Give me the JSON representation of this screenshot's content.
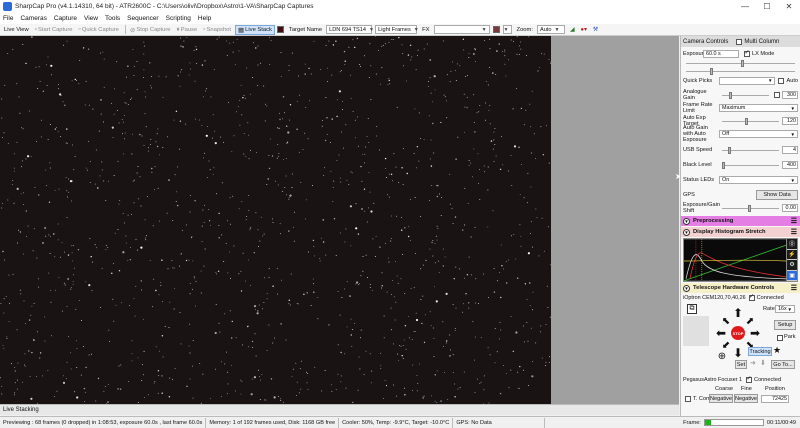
{
  "window": {
    "title": "SharpCap Pro (v4.1.14310, 64 bit) - ATR2600C - C:\\Users\\olivi\\Dropbox\\Astro\\1-VA\\SharpCap Captures",
    "minimize": "—",
    "maximize": "☐",
    "close": "✕"
  },
  "menu": [
    "File",
    "Cameras",
    "Capture",
    "View",
    "Tools",
    "Sequencer",
    "Scripting",
    "Help"
  ],
  "toolbar": {
    "live_view": "Live View",
    "start_capture": "Start Capture",
    "quick_capture": "Quick Capture",
    "stop_capture": "Stop Capture",
    "pause": "Pause",
    "snapshot": "Snapshot",
    "live_stack": "Live Stack",
    "target_name_label": "Target Name",
    "target_name_value": "LDN 694 TS14",
    "frame_type": "Light Frames",
    "fx_label": "FX",
    "zoom_label": "Zoom:",
    "zoom_value": "Auto",
    "colors": {
      "swatch1": "#3a1010",
      "swatch2": "#7a3a3a"
    }
  },
  "bottom_tab": "Live Stacking",
  "status": {
    "previewing": "Previewing : 68 frames (0 dropped) in 1:08:53, exposure 60.0s , last frame 60.0s",
    "memory": "Memory: 1 of 192 frames used, Disk: 1168 GB free",
    "cooler": "Cooler: 50%, Temp: -9.9°C, Target: -10.0°C",
    "gps": "GPS: No Data",
    "frame_label": "Frame:",
    "frame_progress": 0.1,
    "frame_time": "00:11/00:49"
  },
  "panel": {
    "header": "Camera Controls",
    "multi_column": "Multi Column",
    "exposure_label": "Exposure",
    "exposure_value": "60.0 s",
    "lx_mode": "LX Mode",
    "quick_picks": "Quick Picks",
    "auto": "Auto",
    "analogue_gain_label": "Analogue Gain",
    "analogue_gain_value": "300",
    "frame_rate_label": "Frame Rate Limit",
    "frame_rate_value": "Maximum",
    "auto_exp_target_label": "Auto Exp Target",
    "auto_exp_target_value": "120",
    "auto_gain_label": "Auto Gain with Auto Exposure",
    "auto_gain_value": "Off",
    "usb_speed_label": "USB Speed",
    "usb_speed_value": "4",
    "black_level_label": "Black Level",
    "black_level_value": "400",
    "status_leds_label": "Status LEDs",
    "status_leds_value": "On",
    "gps_label": "GPS",
    "show_data": "Show Data",
    "exp_gain_shift_label": "Exposure/Gain Shift",
    "exp_gain_shift_value": "0.00",
    "preprocessing": "Preprocessing",
    "histogram": "Display Histogram Stretch",
    "telescope": "Telescope Hardware Controls",
    "mount_name": "iOptron CEM120,70,40,26",
    "connected": "Connected",
    "rate_label": "Rate:",
    "rate_value": "16x",
    "stop": "STOP",
    "setup": "Setup",
    "park": "Park",
    "tracking": "Tracking",
    "set": "Set",
    "goto": "Go To...",
    "focuser_name": "PegasusAstro Focuser 1",
    "coarse": "Coarse",
    "fine": "Fine",
    "position": "Position",
    "t_comp": "T. Comp",
    "negative1": "Negative",
    "negative2": "Negative",
    "position_value": "72425"
  }
}
